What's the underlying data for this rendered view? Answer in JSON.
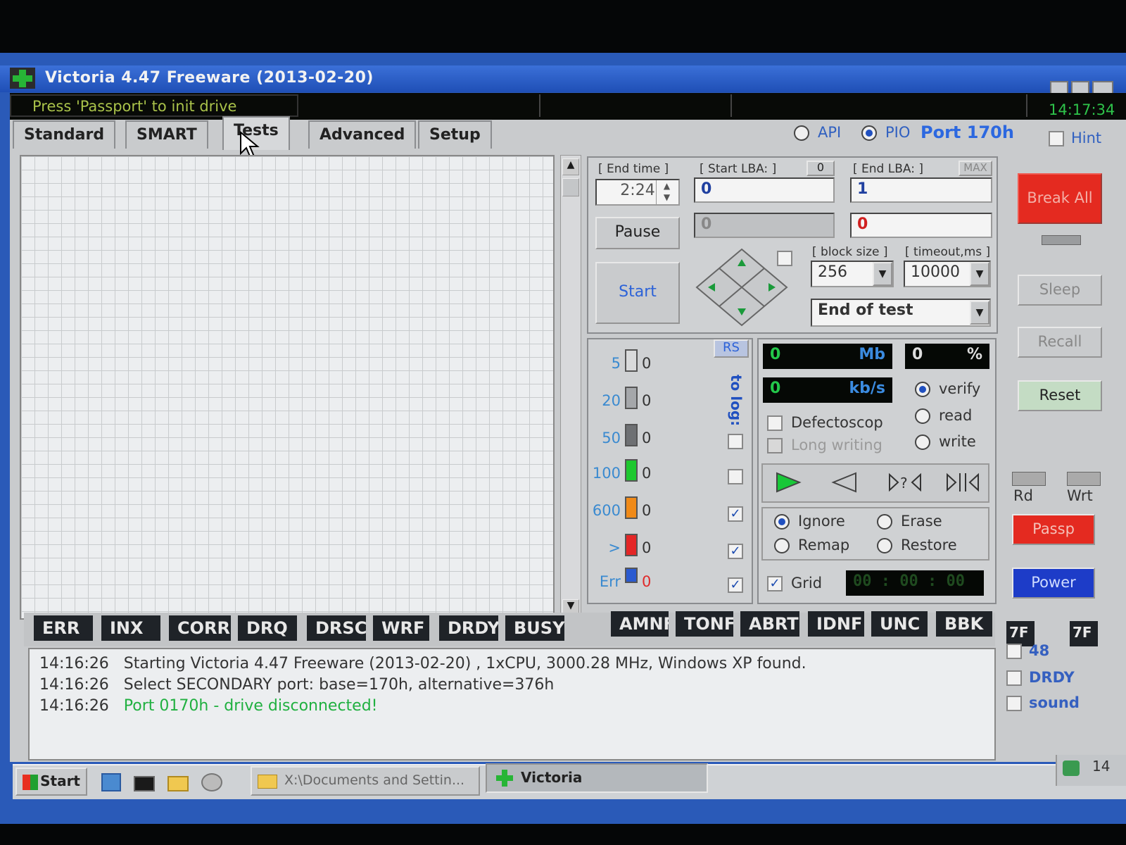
{
  "window": {
    "title": "Victoria 4.47  Freeware (2013-02-20)"
  },
  "statusbar": {
    "message": "Press 'Passport' to init drive",
    "clock": "14:17:34"
  },
  "tabs": [
    "Standard",
    "SMART",
    "Tests",
    "Advanced",
    "Setup"
  ],
  "port": {
    "api_label": "API",
    "pio_label": "PIO",
    "port_label": "Port 170h",
    "hint_label": "Hint"
  },
  "test": {
    "end_time_label": "[ End time ]",
    "end_time": "2:24",
    "start_lba_label": "[ Start LBA: ]",
    "start_lba_btn": "0",
    "start_lba": "0",
    "start_lba_current": "0",
    "end_lba_label": "[ End LBA: ]",
    "end_lba_btn": "MAX",
    "end_lba": "1",
    "end_lba_current": "0",
    "pause_label": "Pause",
    "start_label": "Start",
    "block_size_label": "[ block size ]",
    "block_size": "256",
    "timeout_label": "[ timeout,ms ]",
    "timeout": "10000",
    "end_action": "End of test"
  },
  "stats": {
    "rs_label": "RS",
    "to_log_label": "to log:",
    "rows": [
      {
        "label": "5",
        "count": "0",
        "color": "#d9dadb"
      },
      {
        "label": "20",
        "count": "0",
        "color": "#a5a7aa"
      },
      {
        "label": "50",
        "count": "0",
        "color": "#6e7073"
      },
      {
        "label": "100",
        "count": "0",
        "color": "#1ec82e"
      },
      {
        "label": "600",
        "count": "0",
        "color": "#f08a18"
      },
      {
        "label": ">",
        "count": "0",
        "color": "#e42626"
      },
      {
        "label": "Err",
        "count": "0",
        "color": "#2a5ad0"
      }
    ]
  },
  "speed": {
    "mb": "0",
    "mb_unit": "Mb",
    "pct": "0",
    "pct_unit": "%",
    "kbs": "0",
    "kbs_unit": "kb/s"
  },
  "mode": {
    "verify": "verify",
    "read": "read",
    "write": "write",
    "defectoscop": "Defectoscop",
    "long_writing": "Long writing"
  },
  "action": {
    "ignore": "Ignore",
    "erase": "Erase",
    "remap": "Remap",
    "restore": "Restore",
    "grid": "Grid",
    "timer": "00 : 00 : 00"
  },
  "side": {
    "break_all": "Break All",
    "sleep": "Sleep",
    "recall": "Recall",
    "reset": "Reset",
    "rd": "Rd",
    "wrt": "Wrt",
    "passp": "Passp",
    "power": "Power"
  },
  "flags_left": [
    "ERR",
    "INX",
    "CORR",
    "DRQ",
    "DRSC",
    "WRF",
    "DRDY",
    "BUSY"
  ],
  "flags_right": [
    "AMNF",
    "TONF",
    "ABRT",
    "IDNF",
    "UNC",
    "BBK"
  ],
  "reg": {
    "left": "7F",
    "right": "7F",
    "opt48": "48",
    "optdrdy": "DRDY",
    "optsound": "sound"
  },
  "log": [
    {
      "time": "14:16:26",
      "text": "Starting Victoria 4.47  Freeware (2013-02-20) , 1xCPU, 3000.28 MHz, Windows XP found."
    },
    {
      "time": "14:16:26",
      "text": "Select SECONDARY port: base=170h, alternative=376h"
    },
    {
      "time": "14:16:26",
      "text": "Port 0170h - drive disconnected!"
    }
  ],
  "taskbar": {
    "start": "Start",
    "item1": "X:\\Documents and Settin...",
    "item2": "Victoria",
    "tray": "14"
  }
}
